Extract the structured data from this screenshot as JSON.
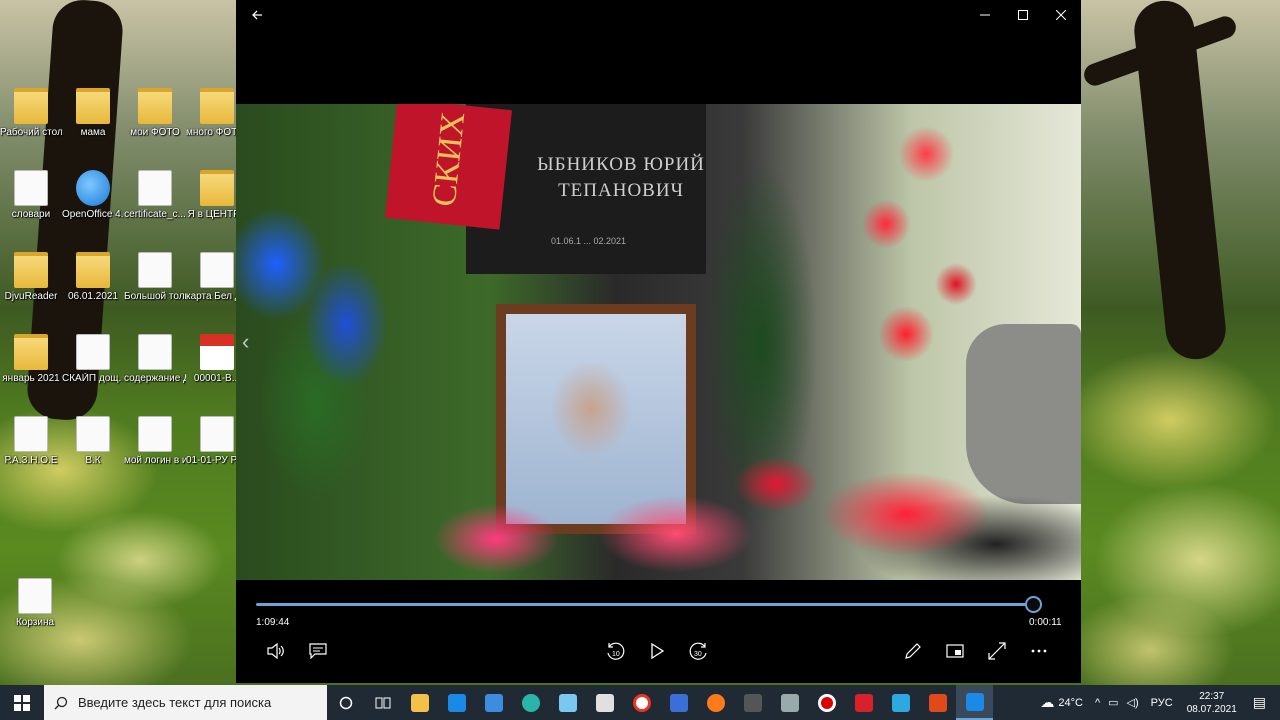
{
  "desktop": {
    "icons": [
      {
        "label": "Рабочий стол - Ярлык",
        "type": "folder"
      },
      {
        "label": "мама",
        "type": "folder"
      },
      {
        "label": "мои ФОТО",
        "type": "folder"
      },
      {
        "label": "много ФОТО с ЦИФРИ",
        "type": "folder"
      },
      {
        "label": "словари",
        "type": "doc"
      },
      {
        "label": "OpenOffice 4.1.9",
        "type": "oo"
      },
      {
        "label": "certificate_c...",
        "type": "doc"
      },
      {
        "label": "Я в ЦЕНТРЕ",
        "type": "folder"
      },
      {
        "label": "DjvuReader",
        "type": "folder"
      },
      {
        "label": "06.01.2021",
        "type": "folder"
      },
      {
        "label": "Большой толковый ...",
        "type": "doc"
      },
      {
        "label": "карта Бел Державы",
        "type": "doc"
      },
      {
        "label": "январь 2021",
        "type": "folder"
      },
      {
        "label": "СКАЙП дощ. Дош...",
        "type": "doc"
      },
      {
        "label": "содержание ДОЩЕЧЕК",
        "type": "doc"
      },
      {
        "label": "00001-B...",
        "type": "pdf"
      },
      {
        "label": "Р.А.З.Н.О.Е",
        "type": "doc"
      },
      {
        "label": "В.К",
        "type": "doc"
      },
      {
        "label": "мой логин в игре РЯЗ",
        "type": "doc"
      },
      {
        "label": "01-01-РУ РЫБАЛК",
        "type": "doc"
      },
      {
        "label": "Корзина",
        "type": "recycle"
      }
    ]
  },
  "player": {
    "video_caption": "ЫБНИКОВ ЮРИЙ ТЕПАНОВИЧ",
    "video_dates": "01.06.1 ... 02.2021",
    "ribbon_text": "СКИХ",
    "elapsed": "1:09:44",
    "remaining": "0:00:11",
    "progress": 0.98
  },
  "taskbar": {
    "search_placeholder": "Введите здесь текст для поиска",
    "weather": "24°C",
    "language": "РУС",
    "time": "22:37",
    "date": "08.07.2021"
  },
  "colors": {
    "accent": "#6aa4d8",
    "taskbar": "#1f2a35",
    "player_bg": "#000000"
  }
}
